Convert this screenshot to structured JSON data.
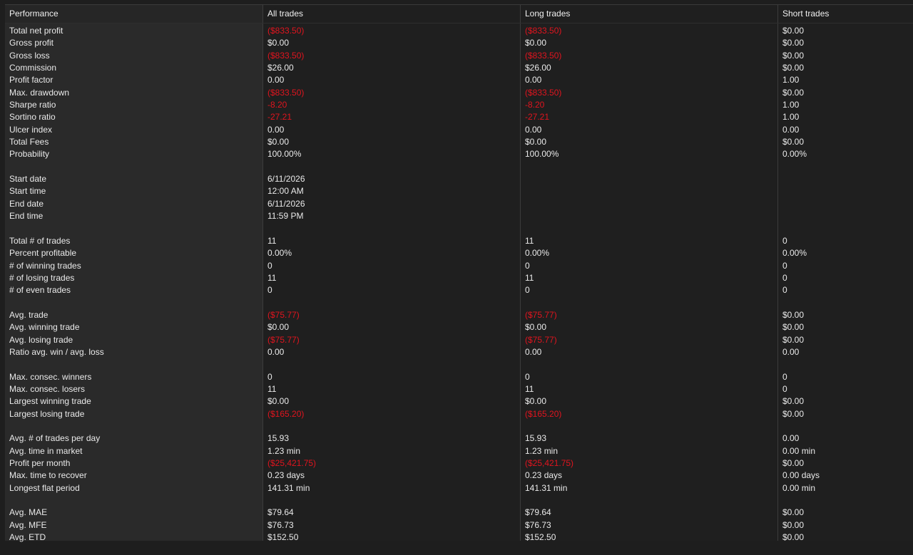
{
  "headers": {
    "label": "Performance",
    "all": "All trades",
    "long": "Long trades",
    "short": "Short trades"
  },
  "rows": [
    {
      "label": "Total net profit",
      "all": "($833.50)",
      "long": "($833.50)",
      "short": "$0.00"
    },
    {
      "label": "Gross profit",
      "all": "$0.00",
      "long": "$0.00",
      "short": "$0.00"
    },
    {
      "label": "Gross loss",
      "all": "($833.50)",
      "long": "($833.50)",
      "short": "$0.00"
    },
    {
      "label": "Commission",
      "all": "$26.00",
      "long": "$26.00",
      "short": "$0.00"
    },
    {
      "label": "Profit factor",
      "all": "0.00",
      "long": "0.00",
      "short": "1.00"
    },
    {
      "label": "Max. drawdown",
      "all": "($833.50)",
      "long": "($833.50)",
      "short": "$0.00"
    },
    {
      "label": "Sharpe ratio",
      "all": "-8.20",
      "long": "-8.20",
      "short": "1.00"
    },
    {
      "label": "Sortino ratio",
      "all": "-27.21",
      "long": "-27.21",
      "short": "1.00"
    },
    {
      "label": "Ulcer index",
      "all": "0.00",
      "long": "0.00",
      "short": "0.00"
    },
    {
      "label": "Total Fees",
      "all": "$0.00",
      "long": "$0.00",
      "short": "$0.00"
    },
    {
      "label": "Probability",
      "all": "100.00%",
      "long": "100.00%",
      "short": "0.00%"
    },
    {
      "gap": true
    },
    {
      "label": "Start date",
      "all": "6/11/2026",
      "long": "",
      "short": ""
    },
    {
      "label": "Start time",
      "all": "12:00 AM",
      "long": "",
      "short": ""
    },
    {
      "label": "End date",
      "all": "6/11/2026",
      "long": "",
      "short": ""
    },
    {
      "label": "End time",
      "all": "11:59 PM",
      "long": "",
      "short": ""
    },
    {
      "gap": true
    },
    {
      "label": "Total # of trades",
      "all": "11",
      "long": "11",
      "short": "0"
    },
    {
      "label": "Percent profitable",
      "all": "0.00%",
      "long": "0.00%",
      "short": "0.00%"
    },
    {
      "label": "# of winning trades",
      "all": "0",
      "long": "0",
      "short": "0"
    },
    {
      "label": "# of losing trades",
      "all": "11",
      "long": "11",
      "short": "0"
    },
    {
      "label": "# of even trades",
      "all": "0",
      "long": "0",
      "short": "0"
    },
    {
      "gap": true
    },
    {
      "label": "Avg. trade",
      "all": "($75.77)",
      "long": "($75.77)",
      "short": "$0.00"
    },
    {
      "label": "Avg. winning trade",
      "all": "$0.00",
      "long": "$0.00",
      "short": "$0.00"
    },
    {
      "label": "Avg. losing trade",
      "all": "($75.77)",
      "long": "($75.77)",
      "short": "$0.00"
    },
    {
      "label": "Ratio avg. win / avg. loss",
      "all": "0.00",
      "long": "0.00",
      "short": "0.00"
    },
    {
      "gap": true
    },
    {
      "label": "Max. consec. winners",
      "all": "0",
      "long": "0",
      "short": "0"
    },
    {
      "label": "Max. consec. losers",
      "all": "11",
      "long": "11",
      "short": "0"
    },
    {
      "label": "Largest winning trade",
      "all": "$0.00",
      "long": "$0.00",
      "short": "$0.00"
    },
    {
      "label": "Largest losing trade",
      "all": "($165.20)",
      "long": "($165.20)",
      "short": "$0.00"
    },
    {
      "gap": true
    },
    {
      "label": "Avg. # of trades per day",
      "all": "15.93",
      "long": "15.93",
      "short": "0.00"
    },
    {
      "label": "Avg. time in market",
      "all": "1.23 min",
      "long": "1.23 min",
      "short": "0.00 min"
    },
    {
      "label": "Profit per month",
      "all": "($25,421.75)",
      "long": "($25,421.75)",
      "short": "$0.00"
    },
    {
      "label": "Max. time to recover",
      "all": "0.23 days",
      "long": "0.23 days",
      "short": "0.00 days"
    },
    {
      "label": "Longest flat period",
      "all": "141.31 min",
      "long": "141.31 min",
      "short": "0.00 min"
    },
    {
      "gap": true
    },
    {
      "label": "Avg. MAE",
      "all": "$79.64",
      "long": "$79.64",
      "short": "$0.00"
    },
    {
      "label": "Avg. MFE",
      "all": "$76.73",
      "long": "$76.73",
      "short": "$0.00"
    },
    {
      "label": "Avg. ETD",
      "all": "$152.50",
      "long": "$152.50",
      "short": "$0.00"
    }
  ],
  "colors": {
    "negative": "#e0141e",
    "text": "#eaeaea",
    "background": "#1e1e1e",
    "label_column": "#2a2a2a"
  }
}
